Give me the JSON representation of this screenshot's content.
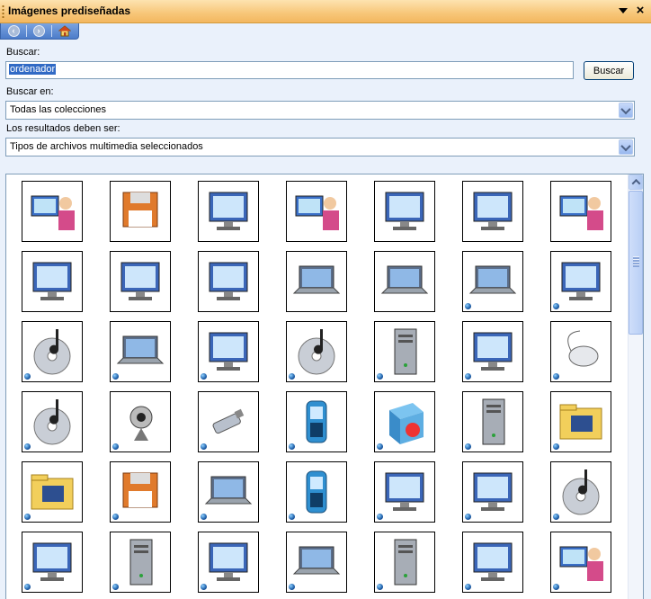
{
  "window": {
    "title": "Imágenes prediseñadas",
    "dropdown_icon": "triangle-down-icon",
    "close_glyph": "×"
  },
  "nav": {
    "back_icon": "back-arrow-icon",
    "forward_icon": "forward-arrow-icon",
    "home_icon": "home-icon"
  },
  "search": {
    "label": "Buscar:",
    "value": "ordenador",
    "button_label": "Buscar"
  },
  "search_in": {
    "label": "Buscar en:",
    "selected": "Todas las colecciones"
  },
  "results_type": {
    "label": "Los resultados deben ser:",
    "selected": "Tipos de archivos multimedia seleccionados"
  },
  "colors": {
    "title_bar": "#f7c678",
    "accent_blue": "#316ac5",
    "pane_background": "#eaf1fb"
  },
  "results": {
    "items": [
      {
        "icon": "person-at-computer-icon",
        "animated": false
      },
      {
        "icon": "floppy-disk-icon",
        "animated": false
      },
      {
        "icon": "network-computer-icon",
        "animated": false
      },
      {
        "icon": "person-plugged-computer-icon",
        "animated": false
      },
      {
        "icon": "desktop-computer-icon",
        "animated": false
      },
      {
        "icon": "abstract-computer-icon",
        "animated": false
      },
      {
        "icon": "person-typing-icon",
        "animated": false
      },
      {
        "icon": "blue-computer-icon",
        "animated": false
      },
      {
        "icon": "beige-computer-icon",
        "animated": false
      },
      {
        "icon": "classic-mac-icon",
        "animated": false
      },
      {
        "icon": "laptop-gray-icon",
        "animated": false
      },
      {
        "icon": "beige-laptop-icon",
        "animated": false
      },
      {
        "icon": "person-with-laptop-icon",
        "animated": true
      },
      {
        "icon": "computer-button-icon",
        "animated": true
      },
      {
        "icon": "music-cd-icon",
        "animated": true
      },
      {
        "icon": "laptop-icon",
        "animated": true
      },
      {
        "icon": "computer-download-icon",
        "animated": true
      },
      {
        "icon": "burning-cd-icon",
        "animated": true
      },
      {
        "icon": "tower-pc-icon",
        "animated": true
      },
      {
        "icon": "flat-monitor-icon",
        "animated": true
      },
      {
        "icon": "computer-mouse-icon",
        "animated": true
      },
      {
        "icon": "music-disc-icon",
        "animated": true
      },
      {
        "icon": "webcam-icon",
        "animated": true
      },
      {
        "icon": "usb-drive-icon",
        "animated": true
      },
      {
        "icon": "pda-icon",
        "animated": true
      },
      {
        "icon": "software-box-icon",
        "animated": true
      },
      {
        "icon": "monitor-tower-icon",
        "animated": true
      },
      {
        "icon": "music-folder-icon",
        "animated": true
      },
      {
        "icon": "computer-folder-icon",
        "animated": true
      },
      {
        "icon": "floppy-add-icon",
        "animated": true
      },
      {
        "icon": "open-laptop-icon",
        "animated": true
      },
      {
        "icon": "smartphone-icon",
        "animated": true
      },
      {
        "icon": "monitor-globe-icon",
        "animated": true
      },
      {
        "icon": "monitor-lock-icon",
        "animated": true
      },
      {
        "icon": "music-cd-blue-icon",
        "animated": true
      },
      {
        "icon": "crt-monitor-icon",
        "animated": true
      },
      {
        "icon": "server-tower-icon",
        "animated": true
      },
      {
        "icon": "monitor-arrow-icon",
        "animated": true
      },
      {
        "icon": "laptop-blue-icon",
        "animated": true
      },
      {
        "icon": "server-gray-icon",
        "animated": true
      },
      {
        "icon": "globe-network-icon",
        "animated": true
      },
      {
        "icon": "computer-user-icon",
        "animated": true
      }
    ]
  }
}
